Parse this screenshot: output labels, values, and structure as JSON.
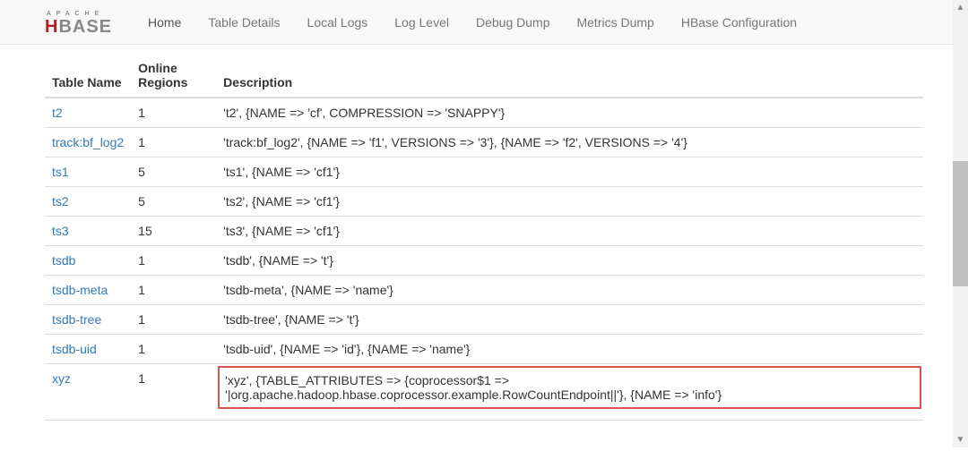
{
  "logo": {
    "top": "APACHE",
    "h": "H",
    "base": "BASE"
  },
  "nav": {
    "items": [
      {
        "label": "Home",
        "active": true
      },
      {
        "label": "Table Details",
        "active": false
      },
      {
        "label": "Local Logs",
        "active": false
      },
      {
        "label": "Log Level",
        "active": false
      },
      {
        "label": "Debug Dump",
        "active": false
      },
      {
        "label": "Metrics Dump",
        "active": false
      },
      {
        "label": "HBase Configuration",
        "active": false
      }
    ]
  },
  "table": {
    "headers": {
      "name": "Table Name",
      "regions": "Online Regions",
      "desc": "Description"
    },
    "rows": [
      {
        "name": "t2",
        "regions": "1",
        "desc": "'t2', {NAME => 'cf', COMPRESSION => 'SNAPPY'}",
        "highlight": false
      },
      {
        "name": "track:bf_log2",
        "regions": "1",
        "desc": "'track:bf_log2', {NAME => 'f1', VERSIONS => '3'}, {NAME => 'f2', VERSIONS => '4'}",
        "highlight": false
      },
      {
        "name": "ts1",
        "regions": "5",
        "desc": "'ts1', {NAME => 'cf1'}",
        "highlight": false
      },
      {
        "name": "ts2",
        "regions": "5",
        "desc": "'ts2', {NAME => 'cf1'}",
        "highlight": false
      },
      {
        "name": "ts3",
        "regions": "15",
        "desc": "'ts3', {NAME => 'cf1'}",
        "highlight": false
      },
      {
        "name": "tsdb",
        "regions": "1",
        "desc": "'tsdb', {NAME => 't'}",
        "highlight": false
      },
      {
        "name": "tsdb-meta",
        "regions": "1",
        "desc": "'tsdb-meta', {NAME => 'name'}",
        "highlight": false
      },
      {
        "name": "tsdb-tree",
        "regions": "1",
        "desc": "'tsdb-tree', {NAME => 't'}",
        "highlight": false
      },
      {
        "name": "tsdb-uid",
        "regions": "1",
        "desc": "'tsdb-uid', {NAME => 'id'}, {NAME => 'name'}",
        "highlight": false
      },
      {
        "name": "xyz",
        "regions": "1",
        "desc": "'xyz', {TABLE_ATTRIBUTES => {coprocessor$1 => '|org.apache.hadoop.hbase.coprocessor.example.RowCountEndpoint||'}, {NAME => 'info'}",
        "highlight": true
      }
    ]
  }
}
